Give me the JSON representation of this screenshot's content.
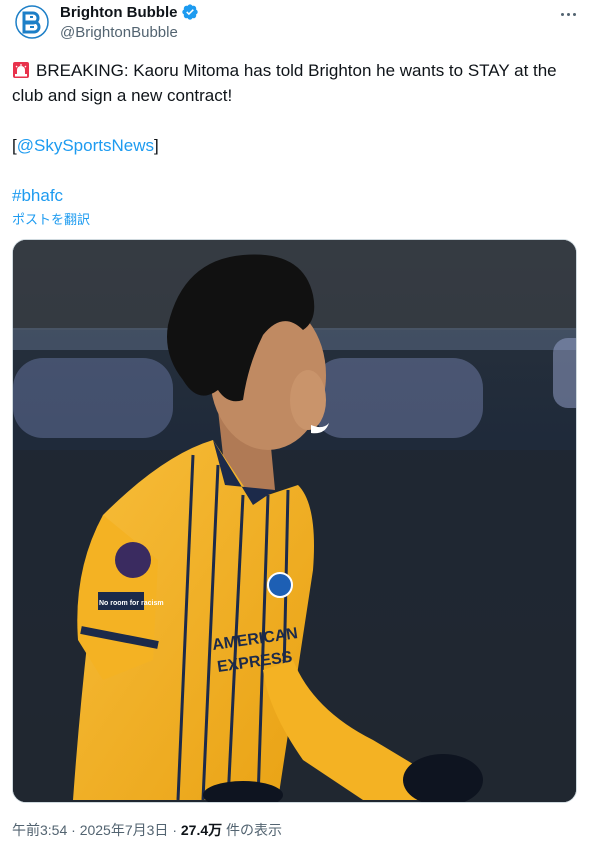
{
  "account": {
    "display_name": "Brighton Bubble",
    "handle": "@BrightonBubble"
  },
  "tweet": {
    "line1": "BREAKING: Kaoru Mitoma has told Brighton he wants to STAY at the club and sign a new contract!",
    "source_open": "[",
    "source_link": "@SkySportsNews",
    "source_close": "]",
    "hashtag": "#bhafc",
    "translate_label": "ポストを翻訳"
  },
  "media": {
    "kit_sponsor_line1": "AMERICAN",
    "kit_sponsor_line2": "EXPRESS",
    "sleeve_badge_text": "No room for racism"
  },
  "footer": {
    "time": "午前3:54",
    "separator": "·",
    "date": "2025年7月3日",
    "views_count": "27.4万",
    "views_label": "件の表示"
  },
  "colors": {
    "link": "#1d9bf0",
    "secondary_text": "#536471",
    "kit_yellow": "#f4b223",
    "kit_navy": "#1c2a4a"
  }
}
